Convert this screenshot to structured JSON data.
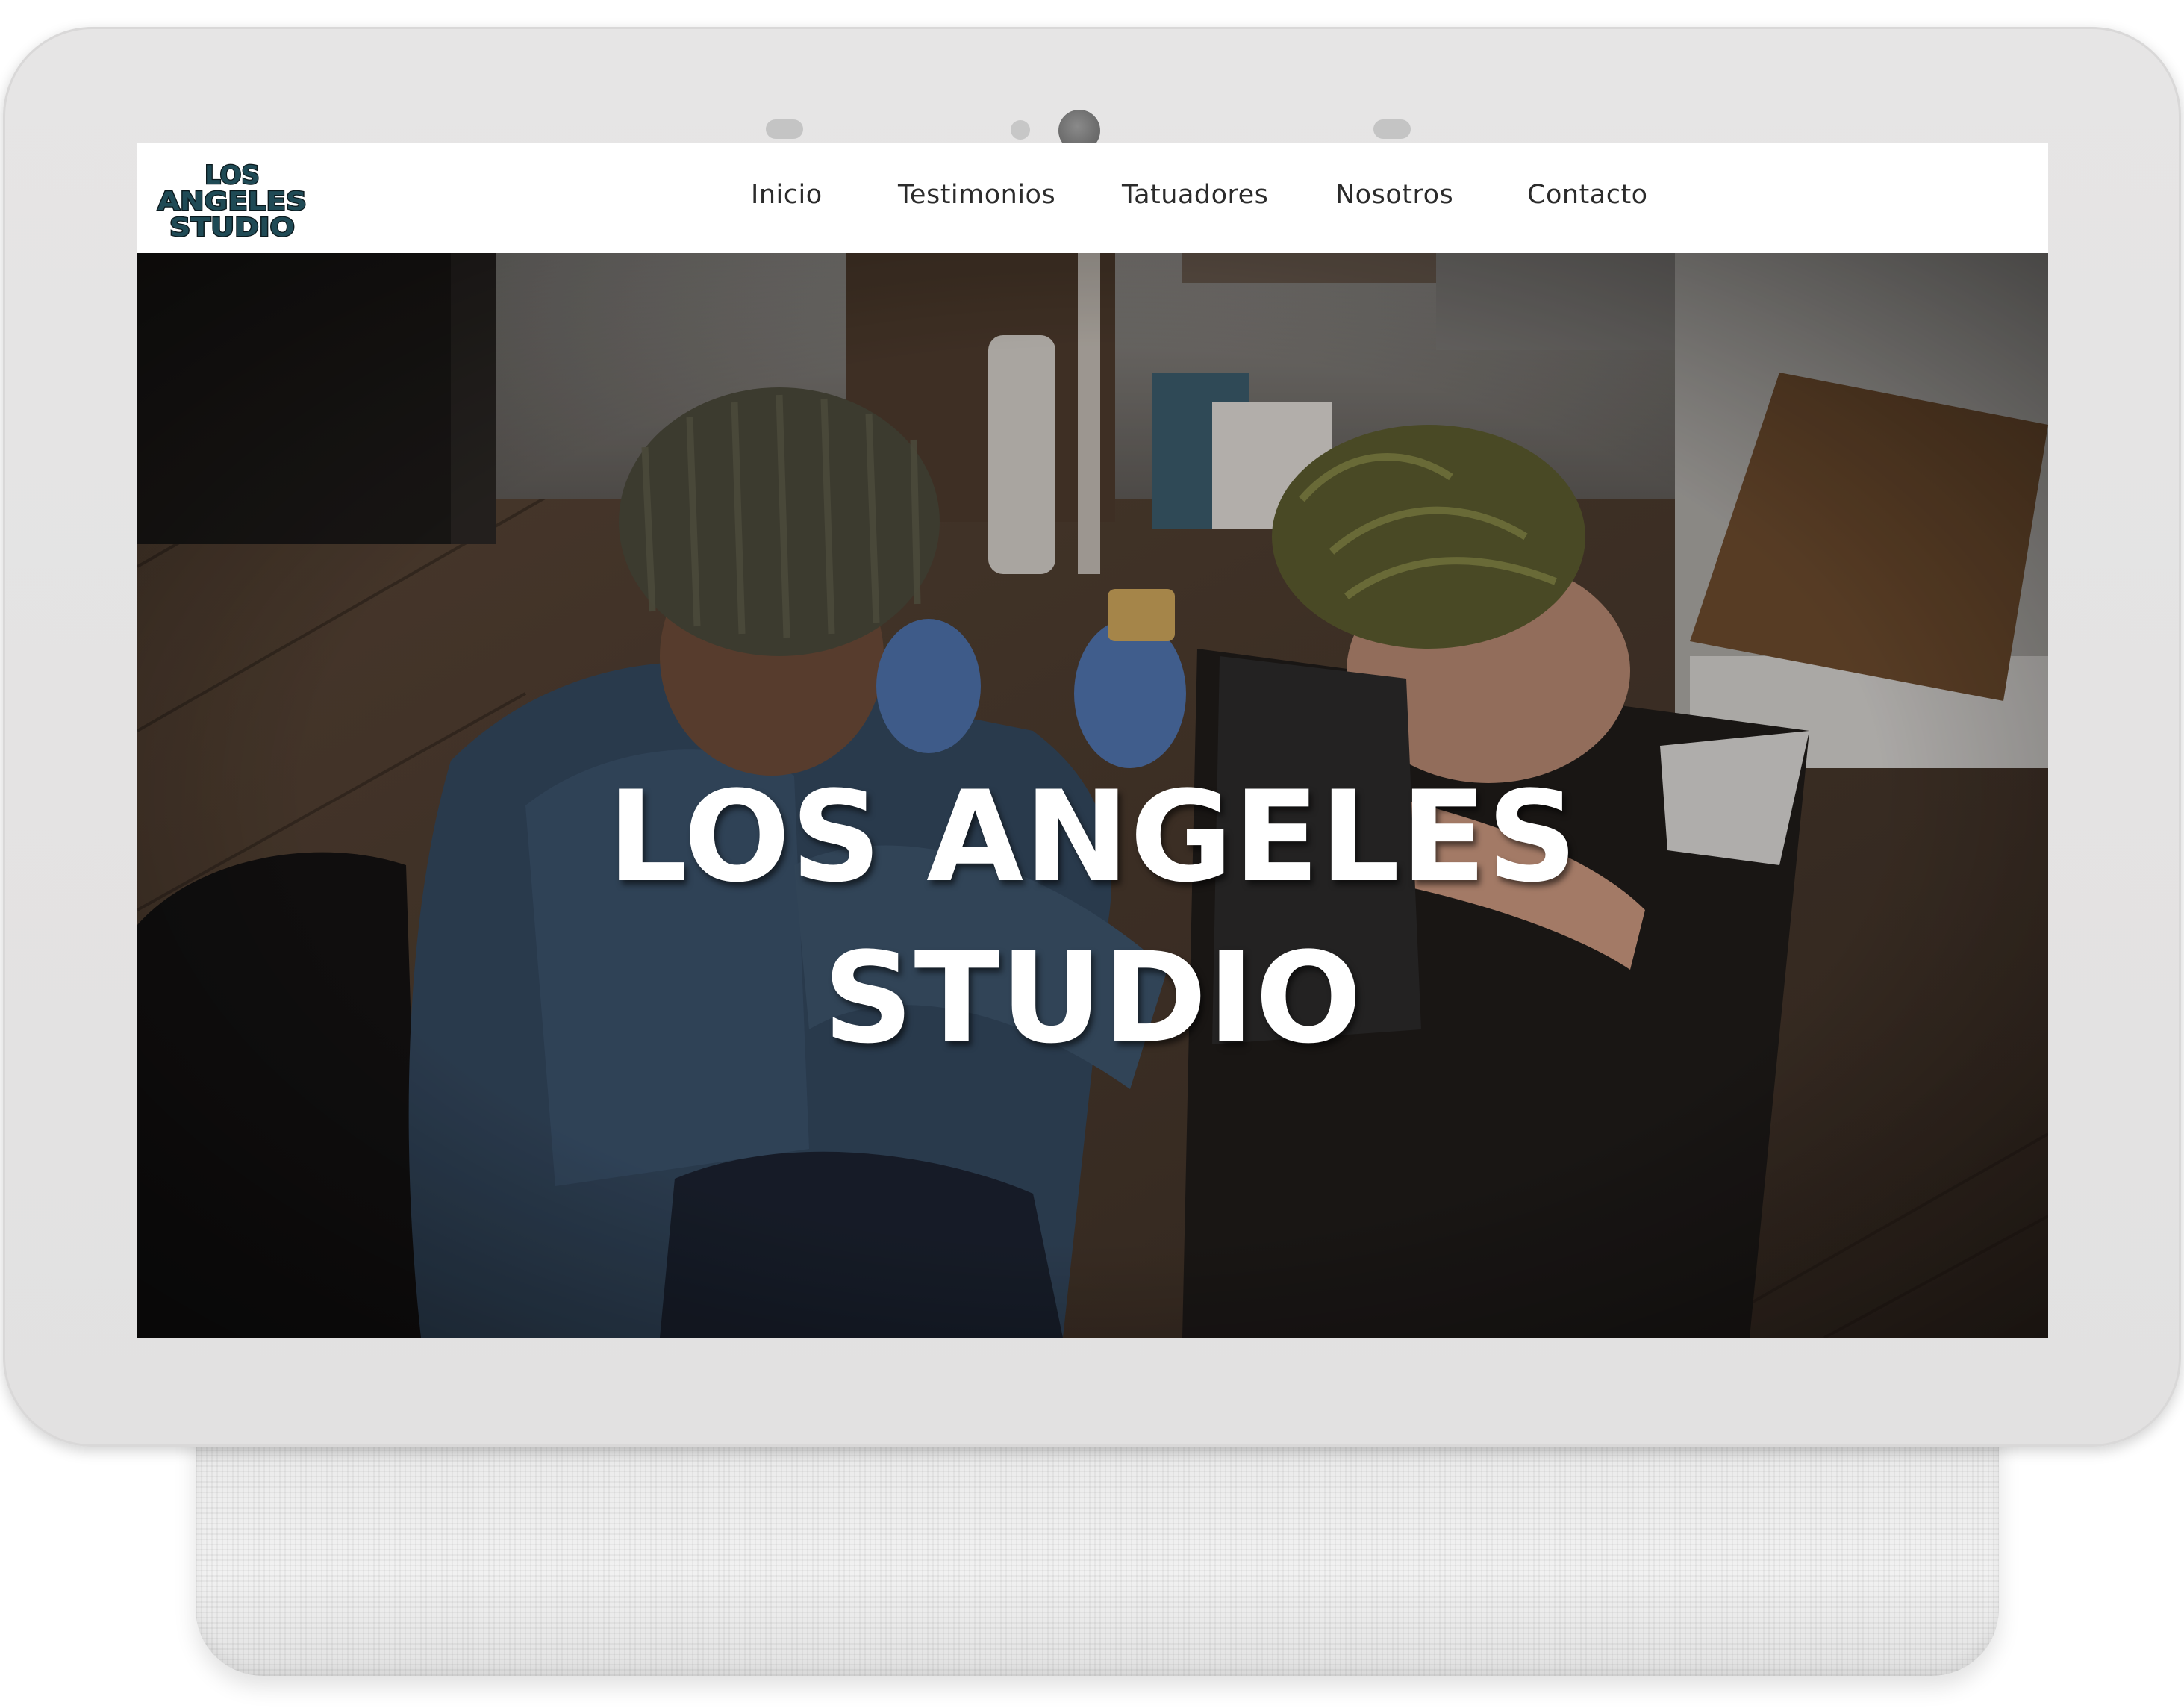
{
  "brand": {
    "logo_lines": [
      "LOS",
      "ANGELES",
      "STUDIO"
    ],
    "logo_color": "#1f4a55"
  },
  "nav": {
    "items": [
      {
        "label": "Inicio"
      },
      {
        "label": "Testimonios"
      },
      {
        "label": "Tatuadores"
      },
      {
        "label": "Nosotros"
      },
      {
        "label": "Contacto"
      }
    ]
  },
  "hero": {
    "title_line1": "LOS ANGELES",
    "title_line2": "STUDIO",
    "image_subject": "tattoo-artist-working-photo"
  },
  "colors": {
    "bezel": "#e4e3e3",
    "nav_bg": "#ffffff",
    "nav_text": "#2b2b2b",
    "hero_text": "#ffffff"
  }
}
